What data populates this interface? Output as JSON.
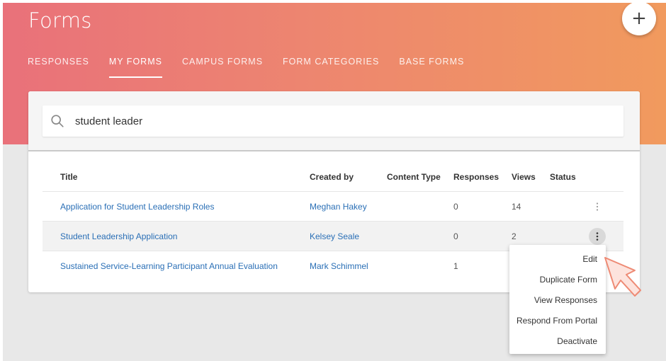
{
  "header": {
    "title": "Forms",
    "fab_label": "+"
  },
  "tabs": [
    {
      "label": "RESPONSES",
      "active": false
    },
    {
      "label": "MY FORMS",
      "active": true
    },
    {
      "label": "CAMPUS FORMS",
      "active": false
    },
    {
      "label": "FORM CATEGORIES",
      "active": false
    },
    {
      "label": "BASE FORMS",
      "active": false
    }
  ],
  "search": {
    "value": "student leader",
    "icon": "search-icon"
  },
  "table": {
    "columns": [
      "Title",
      "Created by",
      "Content Type",
      "Responses",
      "Views",
      "Status"
    ],
    "rows": [
      {
        "title": "Application for Student Leadership Roles",
        "created_by": "Meghan Hakey",
        "content_type": "",
        "responses": "0",
        "views": "14",
        "status": ""
      },
      {
        "title": "Student Leadership Application",
        "created_by": "Kelsey Seale",
        "content_type": "",
        "responses": "0",
        "views": "2",
        "status": ""
      },
      {
        "title": "Sustained Service-Learning Participant Annual Evaluation",
        "created_by": "Mark Schimmel",
        "content_type": "",
        "responses": "1",
        "views": "",
        "status": ""
      }
    ]
  },
  "context_menu": {
    "items": [
      "Edit",
      "Duplicate Form",
      "View Responses",
      "Respond From Portal",
      "Deactivate"
    ]
  },
  "colors": {
    "link": "#2a6fb6",
    "gradient_start": "#e9717a",
    "gradient_end": "#f19a5e",
    "background": "#e8e8e8"
  }
}
